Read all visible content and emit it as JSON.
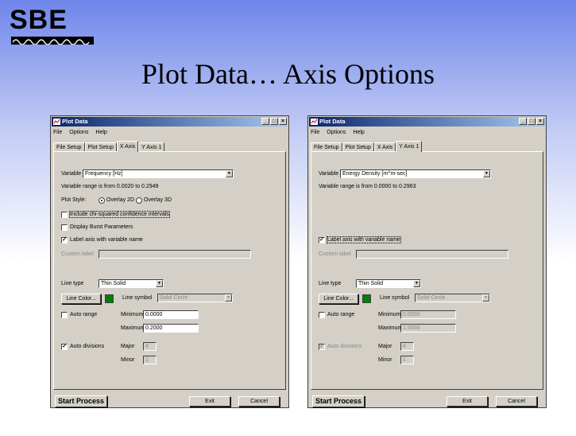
{
  "logo": {
    "text": "SBE"
  },
  "slide_title": "Plot Data… Axis Options",
  "colors": {
    "line_color_swatch": "#008000",
    "titlebar_start": "#0a246a",
    "titlebar_end": "#a6caf0"
  },
  "left_dialog": {
    "title": "Plot Data",
    "menu": [
      "File",
      "Options",
      "Help"
    ],
    "tabs": [
      "File Setup",
      "Plot Setup",
      "X Axis",
      "Y Axis 1"
    ],
    "active_tab": "X Axis",
    "variable_label": "Variable",
    "variable_value": "Frequency [Hz]",
    "range_text": "Variable range is from 0.0020 to 0.2949",
    "plot_style_label": "Plot Style:",
    "overlay_2d": "Overlay 2D",
    "overlay_3d": "Overlay 3D",
    "chi_squared": "Include chi-squared confidence intervals",
    "burst_params": "Display Burst Parameters",
    "label_axis": "Label axis with variable name",
    "custom_label": "Custom label",
    "line_type_label": "Line type",
    "line_type_value": "Thin Solid",
    "line_color_button": "Line Color...",
    "line_symbol_label": "Line symbol",
    "line_symbol_value": "Solid Circle",
    "auto_range": "Auto range",
    "minimum_label": "Minimum",
    "minimum_value": "0.0000",
    "maximum_label": "Maximum",
    "maximum_value": "0.2000",
    "auto_divisions": "Auto divisions",
    "major_label": "Major",
    "major_value": "4",
    "minor_label": "Minor",
    "minor_value": "1",
    "start_button": "Start Process",
    "exit_button": "Exit",
    "cancel_button": "Cancel"
  },
  "right_dialog": {
    "title": "Plot Data",
    "menu": [
      "File",
      "Options",
      "Help"
    ],
    "tabs": [
      "File Setup",
      "Plot Setup",
      "X Axis",
      "Y Axis 1"
    ],
    "active_tab": "Y Axis 1",
    "variable_label": "Variable",
    "variable_value": "Energy Density [m^m-sec]",
    "range_text": "Variable range is from 0.0000 to 0.2963",
    "label_axis": "Label axis with variable name",
    "custom_label": "Custom label",
    "line_type_label": "Line type",
    "line_type_value": "Thin Solid",
    "line_color_button": "Line Color...",
    "line_symbol_label": "Line symbol",
    "line_symbol_value": "Solid Circle",
    "auto_range": "Auto range",
    "minimum_label": "Minimum",
    "minimum_value": "0.0000",
    "maximum_label": "Maximum",
    "maximum_value": "1.5000",
    "auto_divisions": "Auto divisions",
    "major_label": "Major",
    "major_value": "4",
    "minor_label": "Minor",
    "minor_value": "1",
    "start_button": "Start Process",
    "exit_button": "Exit",
    "cancel_button": "Cancel"
  }
}
